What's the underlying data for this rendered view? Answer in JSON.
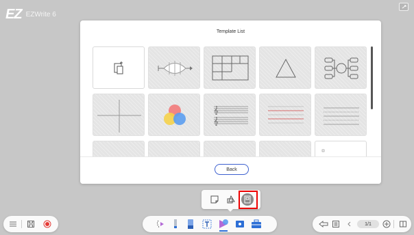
{
  "app": {
    "logo_mark": "EZ",
    "name": "EZWrite 6"
  },
  "dialog": {
    "title": "Template List",
    "back_label": "Back",
    "templates": [
      {
        "name": "blank-template-add"
      },
      {
        "name": "fishbone-diagram"
      },
      {
        "name": "table-grid"
      },
      {
        "name": "triangle"
      },
      {
        "name": "mind-map"
      },
      {
        "name": "coordinate-cross"
      },
      {
        "name": "color-circles"
      },
      {
        "name": "music-staff"
      },
      {
        "name": "red-lines"
      },
      {
        "name": "dotted-lines"
      }
    ]
  },
  "mini_toolbar": {
    "items": [
      "sticky-note-icon",
      "shape-icon",
      "template-icon"
    ],
    "active": "template-icon"
  },
  "bottom_bar": {
    "left": [
      "menu-icon",
      "save-icon",
      "record-icon"
    ],
    "tools": [
      "lasso-icon",
      "pen-icon",
      "eraser-icon",
      "text-select-icon",
      "shape-tool-icon",
      "image-icon",
      "toolbox-icon"
    ],
    "page_indicator": "1/1"
  },
  "colors": {
    "background": "#c7c7c7",
    "accent_blue": "#3b5fcf",
    "highlight_red": "#e00000",
    "record_red": "#e53935"
  }
}
